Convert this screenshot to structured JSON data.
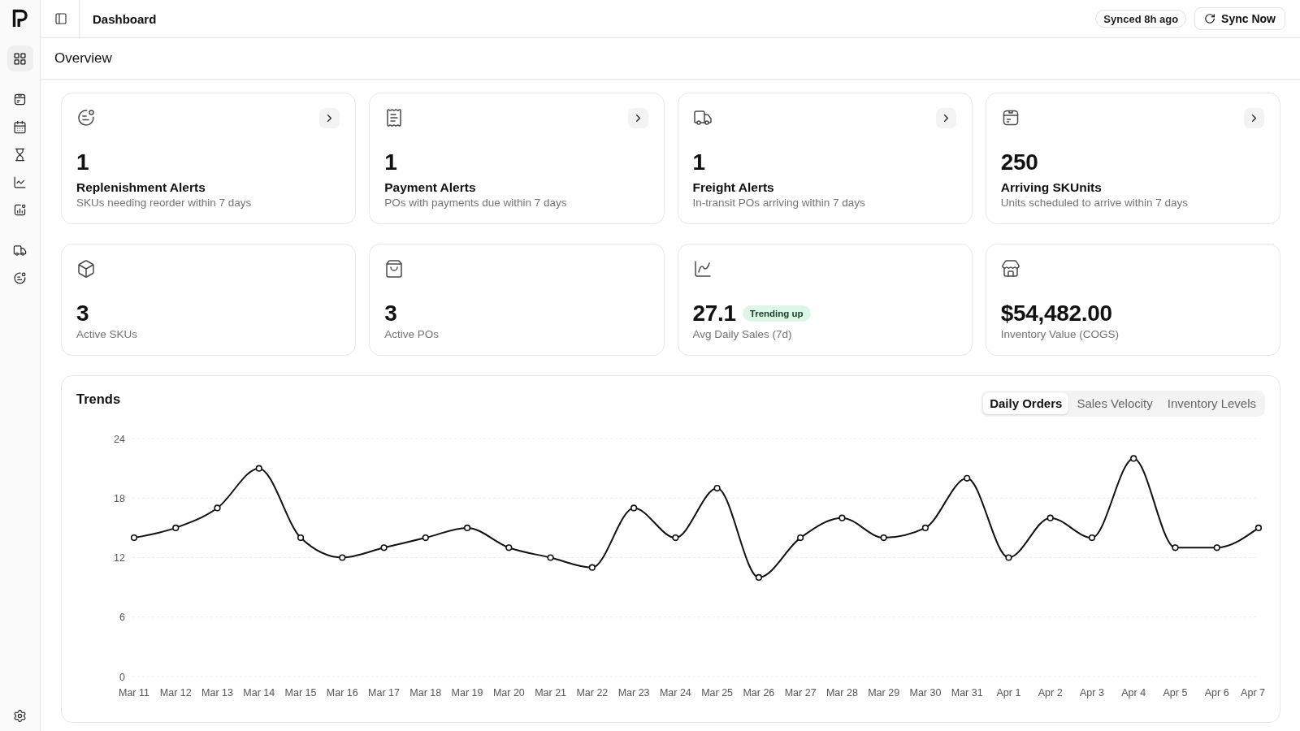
{
  "sidebar": {
    "groups": [
      {
        "items": [
          {
            "selected": true
          }
        ]
      },
      {
        "items": [
          {
            "selected": false
          },
          {
            "selected": false
          },
          {
            "selected": false
          },
          {
            "selected": false
          },
          {
            "selected": false
          }
        ]
      },
      {
        "items": [
          {
            "selected": false
          },
          {
            "selected": false
          }
        ]
      }
    ]
  },
  "header": {
    "title": "Dashboard",
    "sync_status": "Synced 8h ago",
    "sync_button": "Sync Now"
  },
  "page": {
    "title": "Overview"
  },
  "alert_cards": [
    {
      "value": "1",
      "title": "Replenishment Alerts",
      "description": "SKUs needing reorder within 7 days"
    },
    {
      "value": "1",
      "title": "Payment Alerts",
      "description": "POs with payments due within 7 days"
    },
    {
      "value": "1",
      "title": "Freight Alerts",
      "description": "In-transit POs arriving within 7 days"
    },
    {
      "value": "250",
      "title": "Arriving SKUnits",
      "description": "Units scheduled to arrive within 7 days"
    }
  ],
  "stat_cards": [
    {
      "value": "3",
      "label": "Active SKUs"
    },
    {
      "value": "3",
      "label": "Active POs"
    },
    {
      "value": "27.1",
      "badge": "Trending up",
      "label": "Avg Daily Sales (7d)"
    },
    {
      "value": "$54,482.00",
      "label": "Inventory Value (COGS)"
    }
  ],
  "trends": {
    "title": "Trends",
    "tabs": [
      {
        "label": "Daily Orders",
        "selected": true
      },
      {
        "label": "Sales Velocity",
        "selected": false
      },
      {
        "label": "Inventory Levels",
        "selected": false
      }
    ],
    "chart_data": {
      "type": "line",
      "categories": [
        "Mar 11",
        "Mar 12",
        "Mar 13",
        "Mar 14",
        "Mar 15",
        "Mar 16",
        "Mar 17",
        "Mar 18",
        "Mar 19",
        "Mar 20",
        "Mar 21",
        "Mar 22",
        "Mar 23",
        "Mar 24",
        "Mar 25",
        "Mar 26",
        "Mar 27",
        "Mar 28",
        "Mar 29",
        "Mar 30",
        "Mar 31",
        "Apr 1",
        "Apr 2",
        "Apr 3",
        "Apr 4",
        "Apr 5",
        "Apr 6",
        "Apr 7"
      ],
      "series": [
        {
          "color": "#111111",
          "marker": true,
          "values": [
            14,
            15,
            17,
            21,
            14,
            12,
            13,
            14,
            15,
            13,
            12,
            11,
            17,
            14,
            19,
            10,
            14,
            16,
            14,
            15,
            20,
            12,
            16,
            14,
            22,
            13,
            13,
            15
          ]
        }
      ],
      "ylim": [
        0,
        24
      ],
      "yticks": [
        0,
        6,
        12,
        18,
        24
      ],
      "grid": true
    }
  }
}
